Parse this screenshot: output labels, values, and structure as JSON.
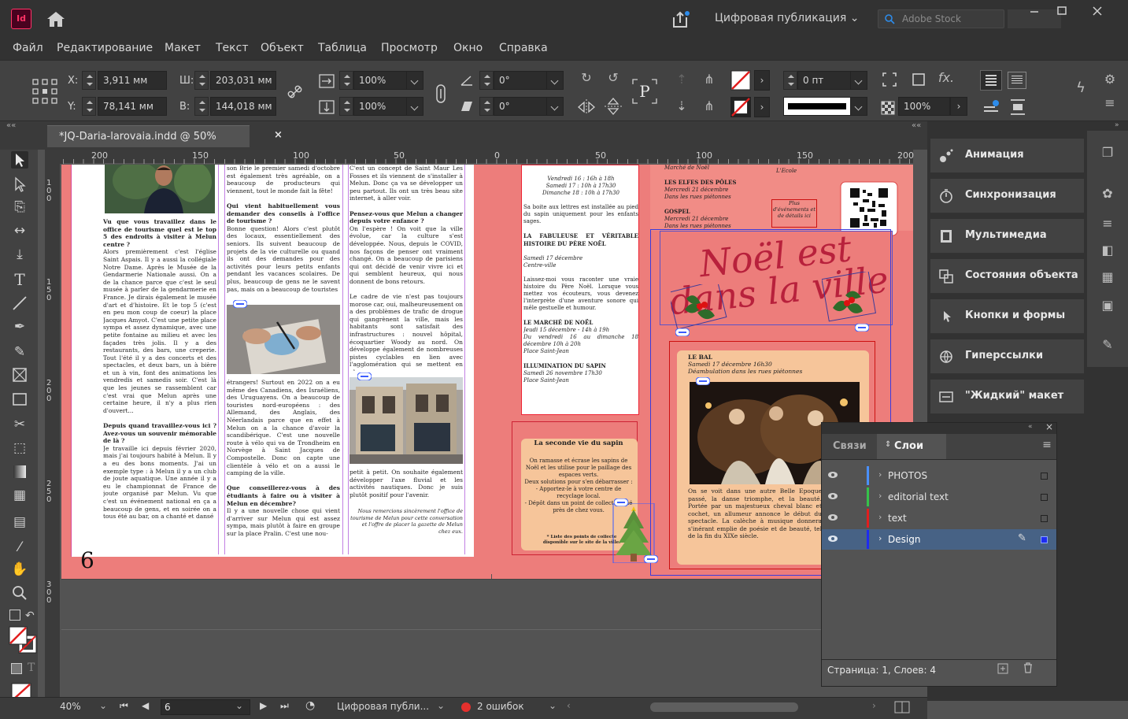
{
  "app": {
    "logo": "Id",
    "workspace": "Цифровая публикация",
    "search_placeholder": "Adobe Stock"
  },
  "menu": [
    "Файл",
    "Редактирование",
    "Макет",
    "Текст",
    "Объект",
    "Таблица",
    "Просмотр",
    "Окно",
    "Справка"
  ],
  "control": {
    "x_label": "X:",
    "x_value": "3,911 мм",
    "y_label": "Y:",
    "y_value": "78,141 мм",
    "w_label": "Ш:",
    "w_value": "203,031 мм",
    "h_label": "В:",
    "h_value": "144,018 мм",
    "scale_x": "100%",
    "scale_y": "100%",
    "rotate": "0°",
    "shear": "0°",
    "stroke_weight": "0 пт",
    "opacity": "100%"
  },
  "document": {
    "tab_title": "*JQ-Daria-larovaia.indd @ 50%",
    "close": "×"
  },
  "ruler": {
    "h_ticks": [
      "200",
      "150",
      "100",
      "50",
      "0",
      "50",
      "100",
      "150",
      "200"
    ],
    "v_ticks": [
      "100",
      "150",
      "200",
      "250",
      "300"
    ]
  },
  "page_content": {
    "page_number": "6",
    "col1_heading": "Vu que vous travaillez dans le office de tourisme quel est le top 5 des endroits à visiter à Melun centre ?",
    "col1_body": "Alors premièrement c'est l'église Saint Aspais. Il y a aussi la collégiale Notre Dame. Après le Musée de la Gendarmerie Nationale aussi. On a de la chance parce que c'est le seul musée à parler de la gendarmerie en France. Je dirais également le musée d'art et d'histoire. Et le top 5 (c'est en peu mon coup de coeur) la place Jacques Amyot. C'est une petite place sympa et assez dynamique, avec une petite fontaine au milieu et avec les façades très jolis. Il y a des restaurants, des bars, une creperie. Tout l'été il y a des concerts et des spectacles, et deux bars, un à bière et un à vin, font des animations les vendredis et samedis soir. C'est là que les jeunes se rassemblent car c'est vrai que Melun après une certaine heure, il n'y a plus rien d'ouvert...",
    "col1_heading2": "Depuis quand travaillez-vous ici ? Avez-vous un souvenir mémorable de là ?",
    "col1_body2": "Je travaille ici depuis février 2020, mais j'ai toujours habité à Melun. Il y a eu des bons moments. J'ai un exemple type : à Melun il y a un club de joute aquatique. Une année il y a eu le championnat de France de joute organisé par Melun. Vu que c'est un événement national en ça a beaucoup de gens, et en soirée on a tous été au bar, on a chanté et dansé",
    "col2_top": "son Brie le premier samedi d'octobre est également très agréable, on a beaucoup de producteurs qui viennent, tout le monde fait la fête!",
    "col2_heading": "Qui vient habituellement vous demander des conseils à l'office de tourisme ?",
    "col2_body": "Bonne question! Alors c'est plutôt des locaux, essentiellement des seniors. Ils suivent beaucoup de projets de la vie culturelle ou quand ils ont des demandes pour des activités pour leurs petits enfants pendant les vacances scolaires. De plus, beaucoup de gens ne le savent pas, mais on a beaucoup de touristes",
    "col2_body2": "étrangers! Surtout en 2022 on a eu même des Canadiens, des Israéliens, des Uruguayens. On a beaucoup de touristes nord-européens : des Allemand, des Anglais, des Néerlandais parce que en effet à Melun on a la chance d'avoir la scandibérique. C'est une nouvelle route à vélo qui va de Trondheim en Norvège à Saint Jacques de Compostelle. Donc on capte une clientèle à vélo et on a aussi le camping de la ville.",
    "col2_heading2": "Que conseillerez-vous à des étudiants à faire ou à visiter à Melun en décembre?",
    "col2_body3": "Il y a une nouvelle chose qui vient d'arriver sur Melun qui est assez sympa, mais plutôt à faire en groupe sur la place Pralin. C'est une nou-",
    "col3_top": "C'est un concept de Saint Maur Les Fosses et ils viennent de s'installer à Melun. Donc ça va se développer un peu partout. Ils ont un très beau site internet, à aller voir.",
    "col3_heading": "Pensez-vous que Melun a changer depuis votre enfance ?",
    "col3_body": "On l'espère ! On voit que la ville évolue, car la culture s'est développée. Nous, depuis le COVID, nos façons de penser ont vraiment changé. On a beaucoup de parisiens qui ont décidé de venir vivre ici et qui semblent heureux, qui nous donnent de bons retours.",
    "col3_body2": "Le cadre de vie n'est pas toujours morose car, oui, malheureusement on a des problèmes de trafic de drogue qui gangrènent la ville, mais les habitants sont satisfait des infrastructures : nouvel hôpital, écoquartier Woody au nord. On développe également de nombreuses pistes cyclables en lien avec l'agglomération qui se mettent en place",
    "col3_body3": "petit à petit. On souhaite également développer l'axe fluvial et les activités nautiques. Donc je suis plutôt positif pour l'avenir.",
    "col3_thanks": "Nous remercions sincèrement l'office de tourisme de Melun pour cette conversation et l'offre de placer la gazette de Melun chez eux.",
    "p2_schedule": "Vendredi 16 : 16h à 18h\nSamedi 17 : 10h à 17h30\nDimanche 18 : 10h à 17h30",
    "p2_letters": "Sa boite aux lettres est installée au pied du sapin uniquement pour les enfants sages.",
    "p2_h1": "LA FABULEUSE ET VÉRITABLE HISTOIRE DU PÈRE NOËL",
    "p2_h1_info": "Samedi 17 décembre\nCentre-ville",
    "p2_h1_body": "Laissez-moi vous raconter une vraie histoire du Père Noël. Lorsque vous mettez vos écouteurs, vous devenez l'interprète d'une aventure sonore qui mêle gestuelle et humour.",
    "p2_h2": "LE MARCHÉ DE NOËL",
    "p2_h2_info": "Jeudi 15 décembre - 14h à 19h\nDu vendredi 16 au dimanche 18 décembre 10h à 20h\nPlace Saint-Jean",
    "p2_h3": "ILLUMINATION DU SAPIN",
    "p2_h3_info": "Samedi 26 novembre 17h30\nPlace Saint-Jean",
    "ticket_title": "La seconde vie du sapin",
    "ticket_body": "On ramasse et écrase les sapins de Noël et les utilise pour le paillage des espaces verts.\nDeux solutions pour s'en débarrasser :\n- Apportez-le à votre centre de recyclage local.\n- Dépôt dans un point de collecte situé près de chez vous.",
    "ticket_note": "* Liste des points de collecte disponible sur le site de la ville.",
    "p3_top": "Marché de Noël",
    "p3_elfes": "LES ELFES DES PÔLES",
    "p3_elfes_info": "Mercredi 21 décembre\nDans les rues piétonnes",
    "p3_gospel": "GOSPEL",
    "p3_gospel_info": "Mercredi 21 décembre\nDans les rues piétonnes",
    "p3_ecole": "L'Ecole",
    "p3_plus": "Plus d'événements et de détails ici",
    "p3_title": "Noël est dans la ville",
    "p3_bal": "LE BAL",
    "p3_bal_info": "Samedi 17 décembre 16h30\nDéambulation dans les rues piétonnes",
    "p3_bal_body": "On se voit dans une autre Belle Epoque passé, la danse triomphe, et la beauté. Portée par un majestueux cheval blanc et cochet, un allumeur annonce le début du spectacle. La calèche à musique donnera s'inérant emplie de poésie et de beauté, tel de la fin du XIXe siècle."
  },
  "panels": [
    "Анимация",
    "Синхронизация",
    "Мультимедиа",
    "Состояния объекта",
    "Кнопки и формы",
    "Гиперссылки",
    "\"Жидкий\" макет"
  ],
  "layers": {
    "tabs": [
      "Связи",
      "Слои"
    ],
    "rows": [
      {
        "name": "PHOTOS",
        "color": "#4a90ff"
      },
      {
        "name": "editorial text",
        "color": "#35c24a"
      },
      {
        "name": "text",
        "color": "#e21e1e"
      },
      {
        "name": "Design",
        "color": "#1e2cf0"
      }
    ],
    "status": "Страница: 1, Слоев: 4"
  },
  "statusbar": {
    "zoom": "40%",
    "page": "6",
    "profile": "Цифровая публи...",
    "errors": "2 ошибок"
  }
}
